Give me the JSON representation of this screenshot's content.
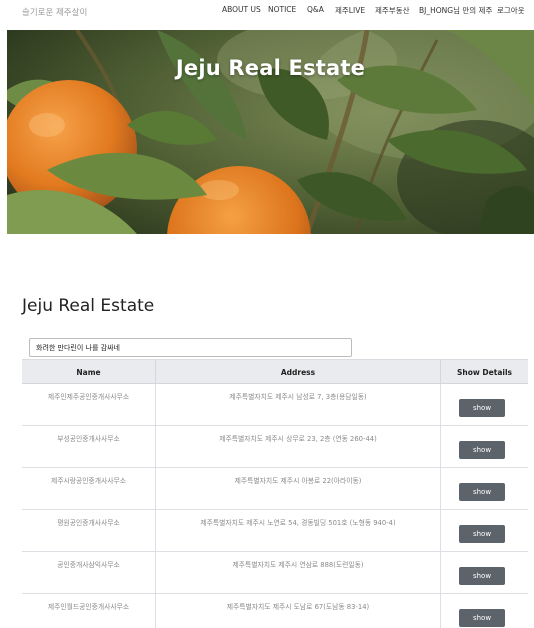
{
  "navbar": {
    "brand": "슬기로운 제주살이",
    "items": [
      {
        "label": "ABOUT US"
      },
      {
        "label": "NOTICE"
      },
      {
        "label": "Q&A"
      },
      {
        "label": "제주LIVE"
      },
      {
        "label": "제주부동산"
      },
      {
        "label": "BJ_HONG님 만의 제주"
      },
      {
        "label": "로그아웃"
      }
    ]
  },
  "hero": {
    "title": "Jeju Real Estate"
  },
  "main": {
    "title": "Jeju Real Estate",
    "search": {
      "value": "화려한 만다린이 나를 감싸네",
      "placeholder": ""
    }
  },
  "table": {
    "headers": {
      "name": "Name",
      "address": "Address",
      "details": "Show Details"
    },
    "rows": [
      {
        "name": "제주인제주공인중개사사무소",
        "address": "제주특별자치도 제주시 남성로 7, 3층(용담일동)",
        "button": "show"
      },
      {
        "name": "부성공인중개사사무소",
        "address": "제주특별자치도 제주시 상무로 23, 2층 (연동 260-44)",
        "button": "show"
      },
      {
        "name": "제주시랑공인중개사사무소",
        "address": "제주특별자치도 제주시 아봉로 22(아라이동)",
        "button": "show"
      },
      {
        "name": "평원공인중개사사무소",
        "address": "제주특별자치도 제주시 노연로 54, 경동빌딩 501호 (노형동 940-4)",
        "button": "show"
      },
      {
        "name": "공인중개사삼익사무소",
        "address": "제주특별자치도 제주시 연삼로 888(도련일동)",
        "button": "show"
      },
      {
        "name": "제주인월드공인중개사사무소",
        "address": "제주특별자치도 제주시 도남로 67(도남동 83-14)",
        "button": "show"
      }
    ]
  }
}
